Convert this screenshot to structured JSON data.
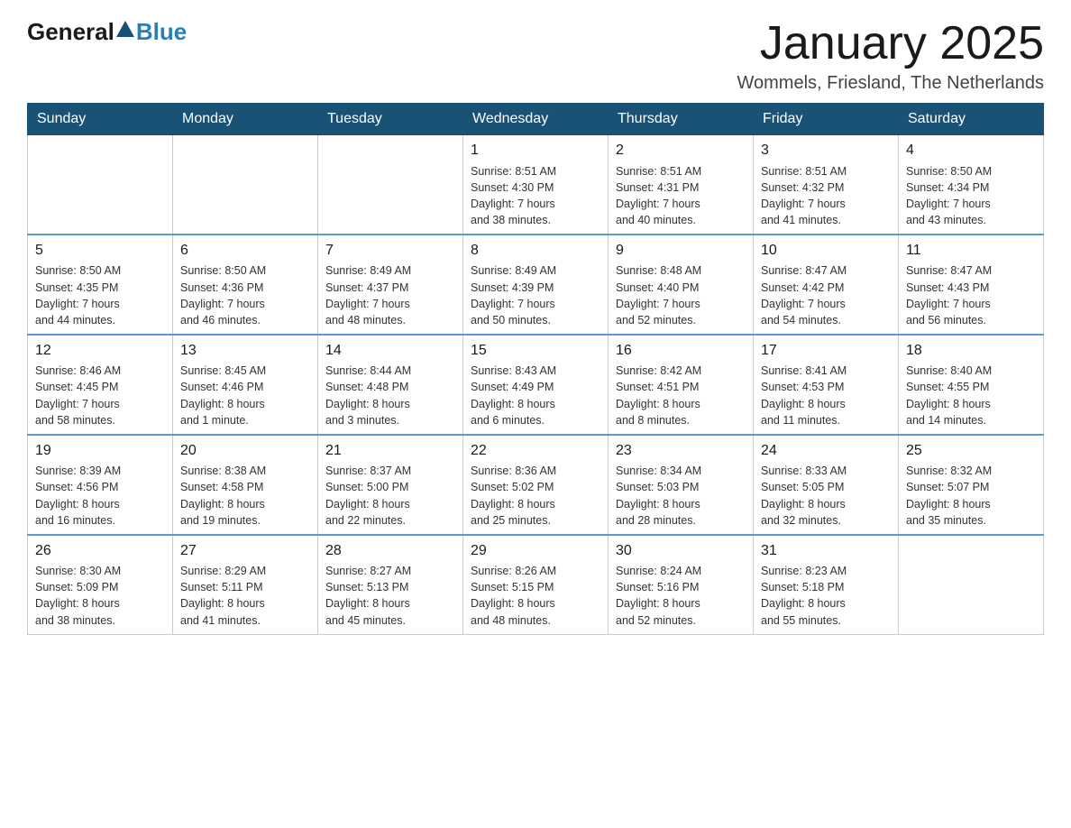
{
  "logo": {
    "general": "General",
    "blue": "Blue"
  },
  "title": "January 2025",
  "location": "Wommels, Friesland, The Netherlands",
  "days_of_week": [
    "Sunday",
    "Monday",
    "Tuesday",
    "Wednesday",
    "Thursday",
    "Friday",
    "Saturday"
  ],
  "weeks": [
    [
      {
        "day": "",
        "info": ""
      },
      {
        "day": "",
        "info": ""
      },
      {
        "day": "",
        "info": ""
      },
      {
        "day": "1",
        "info": "Sunrise: 8:51 AM\nSunset: 4:30 PM\nDaylight: 7 hours\nand 38 minutes."
      },
      {
        "day": "2",
        "info": "Sunrise: 8:51 AM\nSunset: 4:31 PM\nDaylight: 7 hours\nand 40 minutes."
      },
      {
        "day": "3",
        "info": "Sunrise: 8:51 AM\nSunset: 4:32 PM\nDaylight: 7 hours\nand 41 minutes."
      },
      {
        "day": "4",
        "info": "Sunrise: 8:50 AM\nSunset: 4:34 PM\nDaylight: 7 hours\nand 43 minutes."
      }
    ],
    [
      {
        "day": "5",
        "info": "Sunrise: 8:50 AM\nSunset: 4:35 PM\nDaylight: 7 hours\nand 44 minutes."
      },
      {
        "day": "6",
        "info": "Sunrise: 8:50 AM\nSunset: 4:36 PM\nDaylight: 7 hours\nand 46 minutes."
      },
      {
        "day": "7",
        "info": "Sunrise: 8:49 AM\nSunset: 4:37 PM\nDaylight: 7 hours\nand 48 minutes."
      },
      {
        "day": "8",
        "info": "Sunrise: 8:49 AM\nSunset: 4:39 PM\nDaylight: 7 hours\nand 50 minutes."
      },
      {
        "day": "9",
        "info": "Sunrise: 8:48 AM\nSunset: 4:40 PM\nDaylight: 7 hours\nand 52 minutes."
      },
      {
        "day": "10",
        "info": "Sunrise: 8:47 AM\nSunset: 4:42 PM\nDaylight: 7 hours\nand 54 minutes."
      },
      {
        "day": "11",
        "info": "Sunrise: 8:47 AM\nSunset: 4:43 PM\nDaylight: 7 hours\nand 56 minutes."
      }
    ],
    [
      {
        "day": "12",
        "info": "Sunrise: 8:46 AM\nSunset: 4:45 PM\nDaylight: 7 hours\nand 58 minutes."
      },
      {
        "day": "13",
        "info": "Sunrise: 8:45 AM\nSunset: 4:46 PM\nDaylight: 8 hours\nand 1 minute."
      },
      {
        "day": "14",
        "info": "Sunrise: 8:44 AM\nSunset: 4:48 PM\nDaylight: 8 hours\nand 3 minutes."
      },
      {
        "day": "15",
        "info": "Sunrise: 8:43 AM\nSunset: 4:49 PM\nDaylight: 8 hours\nand 6 minutes."
      },
      {
        "day": "16",
        "info": "Sunrise: 8:42 AM\nSunset: 4:51 PM\nDaylight: 8 hours\nand 8 minutes."
      },
      {
        "day": "17",
        "info": "Sunrise: 8:41 AM\nSunset: 4:53 PM\nDaylight: 8 hours\nand 11 minutes."
      },
      {
        "day": "18",
        "info": "Sunrise: 8:40 AM\nSunset: 4:55 PM\nDaylight: 8 hours\nand 14 minutes."
      }
    ],
    [
      {
        "day": "19",
        "info": "Sunrise: 8:39 AM\nSunset: 4:56 PM\nDaylight: 8 hours\nand 16 minutes."
      },
      {
        "day": "20",
        "info": "Sunrise: 8:38 AM\nSunset: 4:58 PM\nDaylight: 8 hours\nand 19 minutes."
      },
      {
        "day": "21",
        "info": "Sunrise: 8:37 AM\nSunset: 5:00 PM\nDaylight: 8 hours\nand 22 minutes."
      },
      {
        "day": "22",
        "info": "Sunrise: 8:36 AM\nSunset: 5:02 PM\nDaylight: 8 hours\nand 25 minutes."
      },
      {
        "day": "23",
        "info": "Sunrise: 8:34 AM\nSunset: 5:03 PM\nDaylight: 8 hours\nand 28 minutes."
      },
      {
        "day": "24",
        "info": "Sunrise: 8:33 AM\nSunset: 5:05 PM\nDaylight: 8 hours\nand 32 minutes."
      },
      {
        "day": "25",
        "info": "Sunrise: 8:32 AM\nSunset: 5:07 PM\nDaylight: 8 hours\nand 35 minutes."
      }
    ],
    [
      {
        "day": "26",
        "info": "Sunrise: 8:30 AM\nSunset: 5:09 PM\nDaylight: 8 hours\nand 38 minutes."
      },
      {
        "day": "27",
        "info": "Sunrise: 8:29 AM\nSunset: 5:11 PM\nDaylight: 8 hours\nand 41 minutes."
      },
      {
        "day": "28",
        "info": "Sunrise: 8:27 AM\nSunset: 5:13 PM\nDaylight: 8 hours\nand 45 minutes."
      },
      {
        "day": "29",
        "info": "Sunrise: 8:26 AM\nSunset: 5:15 PM\nDaylight: 8 hours\nand 48 minutes."
      },
      {
        "day": "30",
        "info": "Sunrise: 8:24 AM\nSunset: 5:16 PM\nDaylight: 8 hours\nand 52 minutes."
      },
      {
        "day": "31",
        "info": "Sunrise: 8:23 AM\nSunset: 5:18 PM\nDaylight: 8 hours\nand 55 minutes."
      },
      {
        "day": "",
        "info": ""
      }
    ]
  ]
}
